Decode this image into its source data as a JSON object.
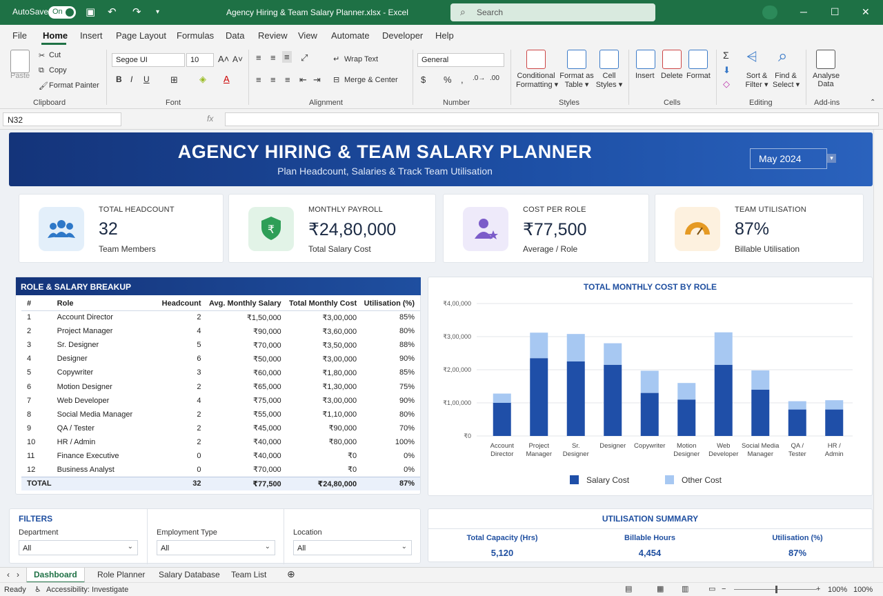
{
  "titlebar": {
    "autosave": "AutoSave",
    "toggle": "On",
    "document_title": "Agency Hiring & Team Salary Planner.xlsx  -  Excel",
    "search_placeholder": "Search"
  },
  "menu": [
    "File",
    "Home",
    "Insert",
    "Page Layout",
    "Formulas",
    "Data",
    "Review",
    "View",
    "Automate",
    "Developer",
    "Help"
  ],
  "ribbon": {
    "paste": "Paste",
    "cut": "Cut",
    "copy": "Copy",
    "format_painter": "Format Painter",
    "font_name": "Segoe UI",
    "font_size": "10",
    "wrap_text": "Wrap Text",
    "merge_center": "Merge & Center",
    "number_format": "General",
    "conditional_formatting": [
      "Conditional",
      "Formatting"
    ],
    "format_as_table": [
      "Format as",
      "Table"
    ],
    "cell_styles": [
      "Cell",
      "Styles"
    ],
    "insert": "Insert",
    "delete": "Delete",
    "format": "Format",
    "sort_filter": [
      "Sort &",
      "Filter"
    ],
    "find_select": [
      "Find &",
      "Select"
    ],
    "analyze_data": [
      "Analyse",
      "Data"
    ],
    "groups": {
      "clipboard": "Clipboard",
      "font": "Font",
      "alignment": "Alignment",
      "number": "Number",
      "styles": "Styles",
      "cells": "Cells",
      "editing": "Editing",
      "addins": "Add-ins"
    }
  },
  "formula_bar": {
    "name_box": "N32",
    "fx": "fx"
  },
  "banner": {
    "title": "AGENCY HIRING & TEAM SALARY PLANNER",
    "subtitle": "Plan Headcount, Salaries & Track Team Utilisation",
    "month": "May 2024"
  },
  "kpis": [
    {
      "label": "TOTAL HEADCOUNT",
      "value": "32",
      "sub": "Team Members",
      "icon": "team-icon",
      "bg": "#e3effa",
      "color": "#2e78c8"
    },
    {
      "label": "MONTHLY PAYROLL",
      "value": "₹24,80,000",
      "sub": "Total Salary Cost",
      "icon": "rupee-shield-icon",
      "bg": "#e2f3e7",
      "color": "#2e9e57"
    },
    {
      "label": "COST PER ROLE",
      "value": "₹77,500",
      "sub": "Average / Role",
      "icon": "person-star-icon",
      "bg": "#eeeafa",
      "color": "#7b5cc9"
    },
    {
      "label": "TEAM UTILISATION",
      "value": "87%",
      "sub": "Billable Utilisation",
      "icon": "gauge-icon",
      "bg": "#fdf1df",
      "color": "#e59a24"
    }
  ],
  "role_table": {
    "title": "ROLE & SALARY BREAKUP",
    "headers": [
      "#",
      "Role",
      "Headcount",
      "Avg. Monthly Salary",
      "Total Monthly Cost",
      "Utilisation (%)"
    ],
    "rows": [
      [
        "1",
        "Account Director",
        "2",
        "₹1,50,000",
        "₹3,00,000",
        "85%"
      ],
      [
        "2",
        "Project Manager",
        "4",
        "₹90,000",
        "₹3,60,000",
        "80%"
      ],
      [
        "3",
        "Sr. Designer",
        "5",
        "₹70,000",
        "₹3,50,000",
        "88%"
      ],
      [
        "4",
        "Designer",
        "6",
        "₹50,000",
        "₹3,00,000",
        "90%"
      ],
      [
        "5",
        "Copywriter",
        "3",
        "₹60,000",
        "₹1,80,000",
        "85%"
      ],
      [
        "6",
        "Motion Designer",
        "2",
        "₹65,000",
        "₹1,30,000",
        "75%"
      ],
      [
        "7",
        "Web Developer",
        "4",
        "₹75,000",
        "₹3,00,000",
        "90%"
      ],
      [
        "8",
        "Social Media Manager",
        "2",
        "₹55,000",
        "₹1,10,000",
        "80%"
      ],
      [
        "9",
        "QA / Tester",
        "2",
        "₹45,000",
        "₹90,000",
        "70%"
      ],
      [
        "10",
        "HR / Admin",
        "2",
        "₹40,000",
        "₹80,000",
        "100%"
      ],
      [
        "11",
        "Finance Executive",
        "0",
        "₹40,000",
        "₹0",
        "0%"
      ],
      [
        "12",
        "Business Analyst",
        "0",
        "₹70,000",
        "₹0",
        "0%"
      ]
    ],
    "total": [
      "TOTAL",
      "",
      "32",
      "₹77,500",
      "₹24,80,000",
      "87%"
    ]
  },
  "chart_data": {
    "type": "bar",
    "stacked": true,
    "title": "TOTAL MONTHLY COST BY ROLE",
    "categories": [
      [
        "Account",
        "Director"
      ],
      [
        "Project",
        "Manager"
      ],
      [
        "Sr.",
        "Designer"
      ],
      [
        "Designer"
      ],
      [
        "Copywriter"
      ],
      [
        "Motion",
        "Designer"
      ],
      [
        "Web",
        "Developer"
      ],
      [
        "Social Media",
        "Manager"
      ],
      [
        "QA /",
        "Tester"
      ],
      [
        "HR /",
        "Admin"
      ]
    ],
    "series": [
      {
        "name": "Salary Cost",
        "color": "#1f4fa8",
        "values": [
          100000,
          235000,
          225000,
          215000,
          130000,
          110000,
          215000,
          140000,
          80000,
          80000
        ]
      },
      {
        "name": "Other Cost",
        "color": "#a7c8f2",
        "values": [
          28000,
          77000,
          83000,
          65000,
          67000,
          50000,
          98000,
          58000,
          25000,
          28000
        ]
      }
    ],
    "ylim": [
      0,
      400000
    ],
    "yticks": [
      "₹0",
      "₹1,00,000",
      "₹2,00,000",
      "₹3,00,000",
      "₹4,00,000"
    ],
    "grid": true,
    "legend": "bottom"
  },
  "filters": {
    "title": "FILTERS",
    "department_label": "Department",
    "department_value": "All",
    "employment_label": "Employment Type",
    "employment_value": "All",
    "location_label": "Location",
    "location_value": "All"
  },
  "utilisation": {
    "title": "UTILISATION SUMMARY",
    "columns": [
      {
        "label": "Total Capacity (Hrs)",
        "value": "5,120"
      },
      {
        "label": "Billable Hours",
        "value": "4,454"
      },
      {
        "label": "Utilisation (%)",
        "value": "87%"
      }
    ]
  },
  "sheet_tabs": [
    "Dashboard",
    "Role Planner",
    "Salary Database",
    "Team List"
  ],
  "status": {
    "ready": "Ready",
    "accessibility": "Accessibility: Investigate",
    "zoom": "100%"
  }
}
